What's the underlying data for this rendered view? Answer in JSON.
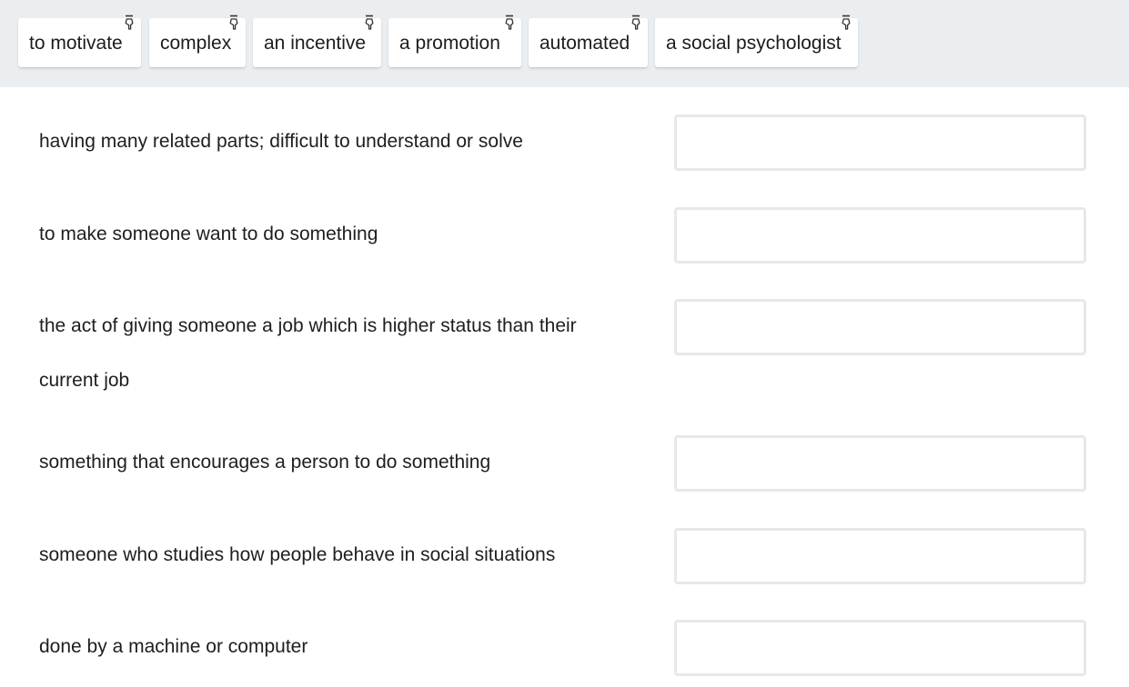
{
  "word_bank": {
    "chips": [
      {
        "label": "to motivate",
        "icon": "drag-hand-icon"
      },
      {
        "label": "complex",
        "icon": "drag-hand-icon"
      },
      {
        "label": "an incentive",
        "icon": "drag-hand-icon"
      },
      {
        "label": "a promotion",
        "icon": "drag-hand-icon"
      },
      {
        "label": "automated",
        "icon": "drag-hand-icon"
      },
      {
        "label": "a social psychologist",
        "icon": "drag-hand-icon"
      }
    ]
  },
  "questions": [
    {
      "definition": "having many related parts; difficult to understand or solve",
      "answer": ""
    },
    {
      "definition": "to make someone want to do something",
      "answer": ""
    },
    {
      "definition": "the act of giving someone a job which is higher status than their current job",
      "answer": ""
    },
    {
      "definition": "something that encourages a person to do something",
      "answer": ""
    },
    {
      "definition": "someone who studies how people behave in social situations",
      "answer": ""
    },
    {
      "definition": "done by a machine or computer",
      "answer": ""
    }
  ],
  "colors": {
    "word_bank_bg": "#eaeef0",
    "drop_box_border": "#e6e8ea",
    "text": "#1c1c1c"
  }
}
